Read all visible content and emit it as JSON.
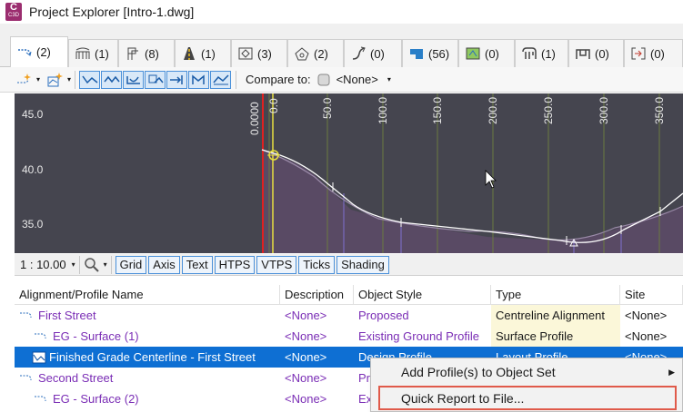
{
  "window": {
    "title": "Project Explorer [Intro-1.dwg]",
    "app_icon_letter": "C",
    "app_icon_sub": "C3D"
  },
  "tabs": [
    {
      "count": "(2)",
      "icon": "alignment-icon",
      "active": true
    },
    {
      "count": "(1)",
      "icon": "bridge-icon"
    },
    {
      "count": "(8)",
      "icon": "flags-icon"
    },
    {
      "count": "(1)",
      "icon": "road-icon"
    },
    {
      "count": "(3)",
      "icon": "intersection-icon"
    },
    {
      "count": "(2)",
      "icon": "parcel-icon"
    },
    {
      "count": "(0)",
      "icon": "pipe-icon"
    },
    {
      "count": "(56)",
      "icon": "surface-icon"
    },
    {
      "count": "(0)",
      "icon": "map-icon"
    },
    {
      "count": "(1)",
      "icon": "structure-icon"
    },
    {
      "count": "(0)",
      "icon": "structure2-icon"
    },
    {
      "count": "(0)",
      "icon": "reference-icon"
    }
  ],
  "toolbar": {
    "compare_label": "Compare to:",
    "compare_value": "<None>"
  },
  "graph": {
    "y_labels": [
      "45.0",
      "40.0",
      "35.0"
    ],
    "x_labels": [
      "0.0000",
      "0.0",
      "50.0",
      "100.0",
      "150.0",
      "200.0",
      "250.0",
      "300.0",
      "350.0"
    ]
  },
  "graph_toolbar": {
    "scale": "1 : 10.00",
    "buttons": [
      "Grid",
      "Axis",
      "Text",
      "HTPS",
      "VTPS",
      "Ticks",
      "Shading"
    ]
  },
  "table": {
    "headers": [
      "Alignment/Profile Name",
      "Description",
      "Object Style",
      "Type",
      "Site"
    ],
    "rows": [
      {
        "name": "First Street",
        "desc": "<None>",
        "style": "Proposed",
        "type": "Centreline Alignment",
        "site": "<None>",
        "indent": 0
      },
      {
        "name": "EG - Surface (1)",
        "desc": "<None>",
        "style": "Existing Ground Profile",
        "type": "Surface Profile",
        "site": "<None>",
        "indent": 1
      },
      {
        "name": "Finished Grade Centerline - First Street",
        "desc": "<None>",
        "style": "Design Profile",
        "type": "Layout Profile",
        "site": "<None>",
        "indent": 1,
        "selected": true
      },
      {
        "name": "Second Street",
        "desc": "<None>",
        "style": "Pr",
        "type": "",
        "site": "",
        "indent": 0
      },
      {
        "name": "EG - Surface (2)",
        "desc": "<None>",
        "style": "Ex",
        "type": "",
        "site": "",
        "indent": 1
      }
    ]
  },
  "context_menu": {
    "items": [
      "Add Profile(s) to Object Set",
      "Quick Report to File..."
    ]
  }
}
